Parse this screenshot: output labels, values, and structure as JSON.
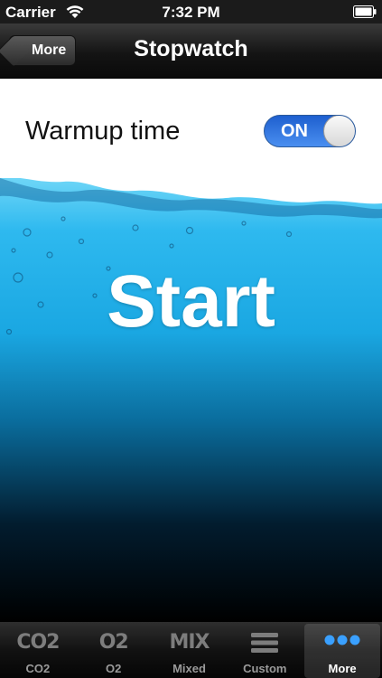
{
  "status_bar": {
    "carrier": "Carrier",
    "time": "7:32 PM"
  },
  "nav": {
    "back_label": "More",
    "title": "Stopwatch"
  },
  "settings": {
    "warmup_label": "Warmup time",
    "warmup_toggle_state": "ON"
  },
  "main": {
    "start_label": "Start"
  },
  "tabs": [
    {
      "glyph": "CO2",
      "label": "CO2",
      "active": false
    },
    {
      "glyph": "O2",
      "label": "O2",
      "active": false
    },
    {
      "glyph": "MIX",
      "label": "Mixed",
      "active": false
    },
    {
      "icon": "list-icon",
      "label": "Custom",
      "active": false
    },
    {
      "icon": "more-dots-icon",
      "label": "More",
      "active": true
    }
  ],
  "colors": {
    "toggle_on": "#2f7fe6",
    "water_light": "#3cc6f4",
    "water_dark": "#000000",
    "active_dots": "#3aa0ff"
  }
}
